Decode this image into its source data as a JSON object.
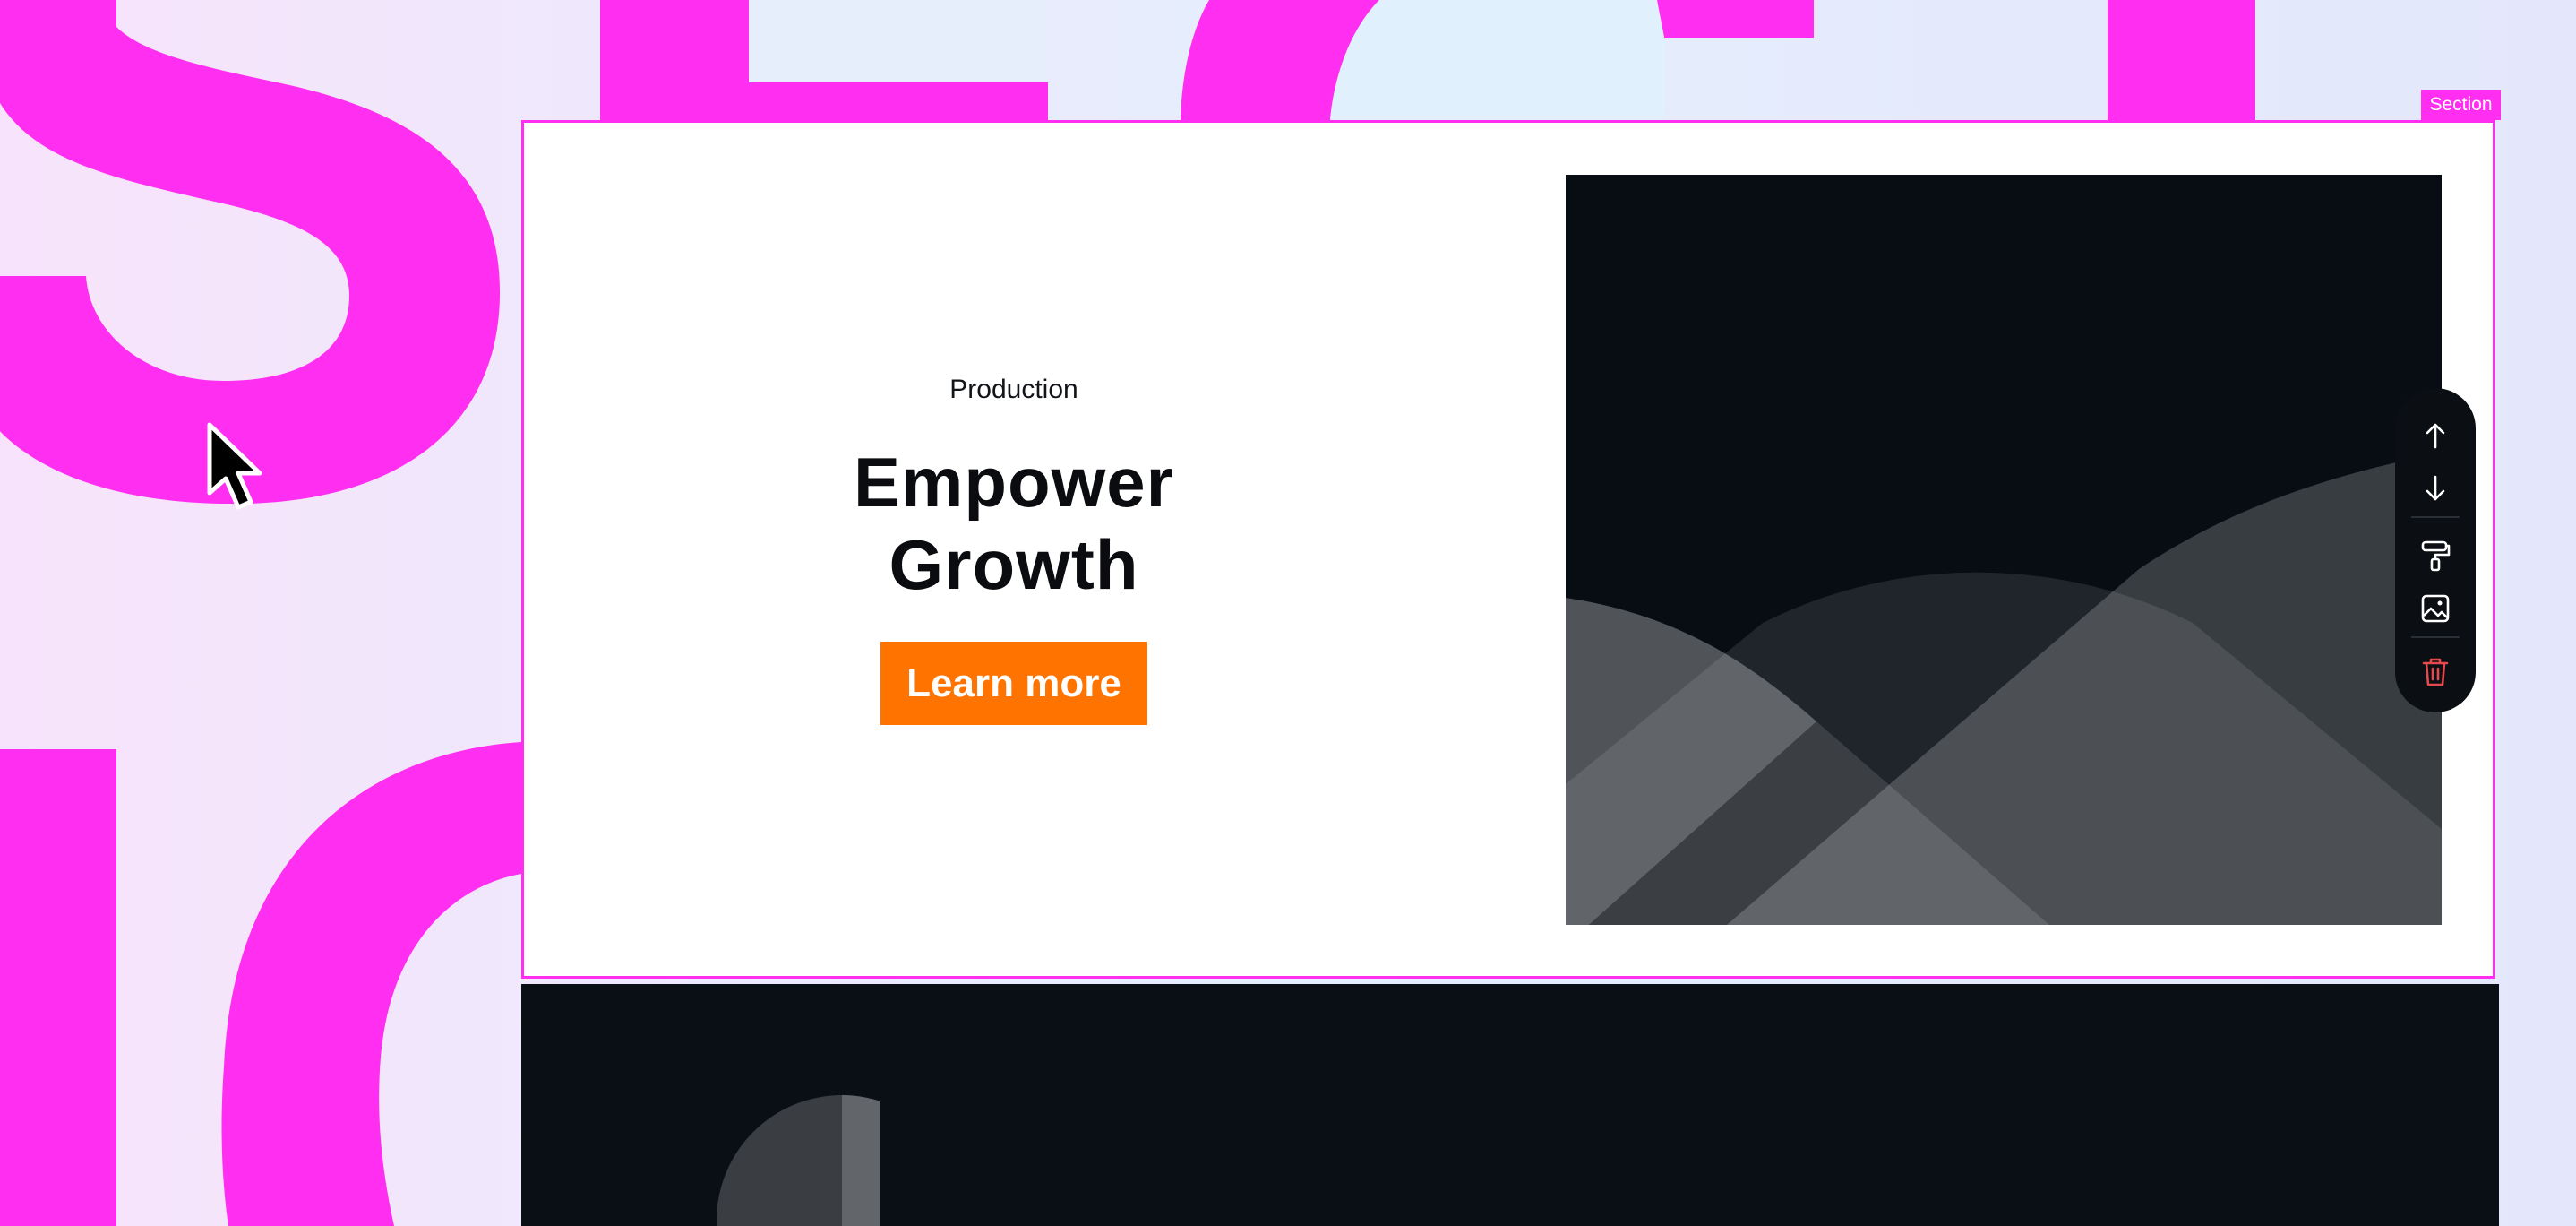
{
  "canvas": {
    "background_letters": [
      "S",
      "e",
      "c",
      "t",
      "i",
      "o",
      "n"
    ],
    "accent_color": "#ff2ef0"
  },
  "section": {
    "tag_label": "Section",
    "eyebrow": "Production",
    "headline_line1": "Empower",
    "headline_line2": "Growth",
    "cta_label": "Learn more",
    "cta_color": "#ff7300",
    "image_icon": "mountain-placeholder-image"
  },
  "toolbar": {
    "items": [
      {
        "name": "move-up",
        "icon": "arrow-up-icon"
      },
      {
        "name": "move-down",
        "icon": "arrow-down-icon"
      },
      {
        "name": "style",
        "icon": "paint-roller-icon"
      },
      {
        "name": "image",
        "icon": "image-icon"
      },
      {
        "name": "delete",
        "icon": "trash-icon",
        "color": "#e5484d"
      }
    ]
  },
  "next_section": {
    "background": "#0a0f15",
    "image_icon": "half-circle-placeholder"
  }
}
